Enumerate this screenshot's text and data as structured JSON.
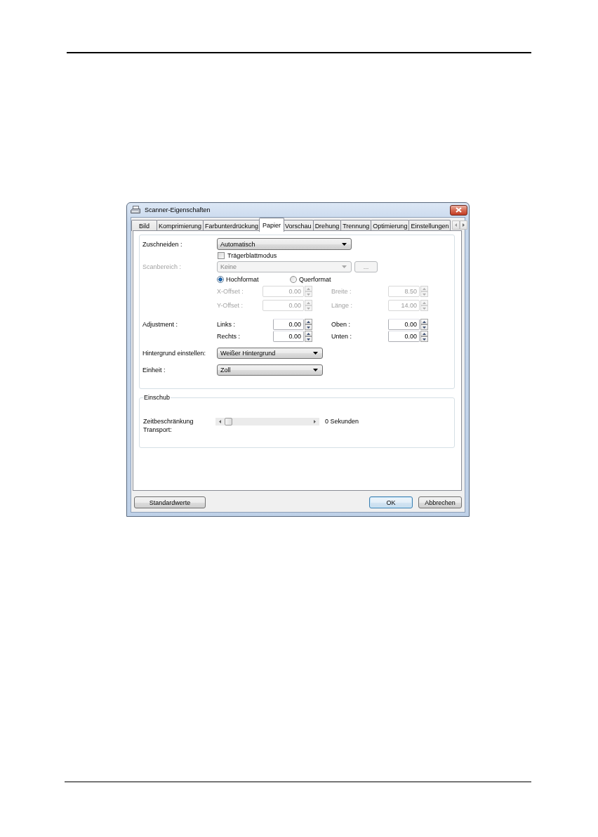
{
  "window": {
    "title": "Scanner-Eigenschaften"
  },
  "tabs": [
    {
      "label": "Bild",
      "selected": false
    },
    {
      "label": "Komprimierung",
      "selected": false
    },
    {
      "label": "Farbunterdrückung",
      "selected": false
    },
    {
      "label": "Papier",
      "selected": true
    },
    {
      "label": "Vorschau",
      "selected": false
    },
    {
      "label": "Drehung",
      "selected": false
    },
    {
      "label": "Trennung",
      "selected": false
    },
    {
      "label": "Optimierung",
      "selected": false
    },
    {
      "label": "Einstellungen",
      "selected": false
    }
  ],
  "crop": {
    "label": "Zuschneiden :",
    "value": "Automatisch"
  },
  "carrier_sheet": {
    "label": "Trägerblattmodus",
    "checked": false
  },
  "scan_area": {
    "label": "Scanbereich :",
    "value": "Keine",
    "button": "...",
    "disabled": true
  },
  "orientation": [
    {
      "label": "Hochformat",
      "selected": true
    },
    {
      "label": "Querformat",
      "selected": false
    }
  ],
  "area_rows": [
    {
      "left": {
        "label": "X-Offset :",
        "value": "0.00",
        "disabled": true
      },
      "right": {
        "label": "Breite :",
        "value": "8.50",
        "disabled": true
      }
    },
    {
      "left": {
        "label": "Y-Offset :",
        "value": "0.00",
        "disabled": true
      },
      "right": {
        "label": "Länge :",
        "value": "14.00",
        "disabled": true
      }
    }
  ],
  "adjustment": {
    "label": "Adjustment :",
    "rows": [
      {
        "left": {
          "label": "Links :",
          "value": "0.00",
          "disabled": false
        },
        "right": {
          "label": "Oben :",
          "value": "0.00",
          "disabled": false
        }
      },
      {
        "left": {
          "label": "Rechts :",
          "value": "0.00",
          "disabled": false
        },
        "right": {
          "label": "Unten :",
          "value": "0.00",
          "disabled": false
        }
      }
    ]
  },
  "background": {
    "label": "Hintergrund einstellen:",
    "value": "Weißer Hintergrund"
  },
  "unit": {
    "label": "Einheit :",
    "value": "Zoll"
  },
  "feed": {
    "title": "Einschub",
    "timeout": {
      "label": "Zeitbeschränkung Transport:",
      "level": 0,
      "reading": "0 Sekunden"
    }
  },
  "buttons": [
    {
      "label": "Standardwerte",
      "default": false
    },
    {
      "label": "OK",
      "default": true
    },
    {
      "label": "Abbrechen",
      "default": false
    }
  ]
}
